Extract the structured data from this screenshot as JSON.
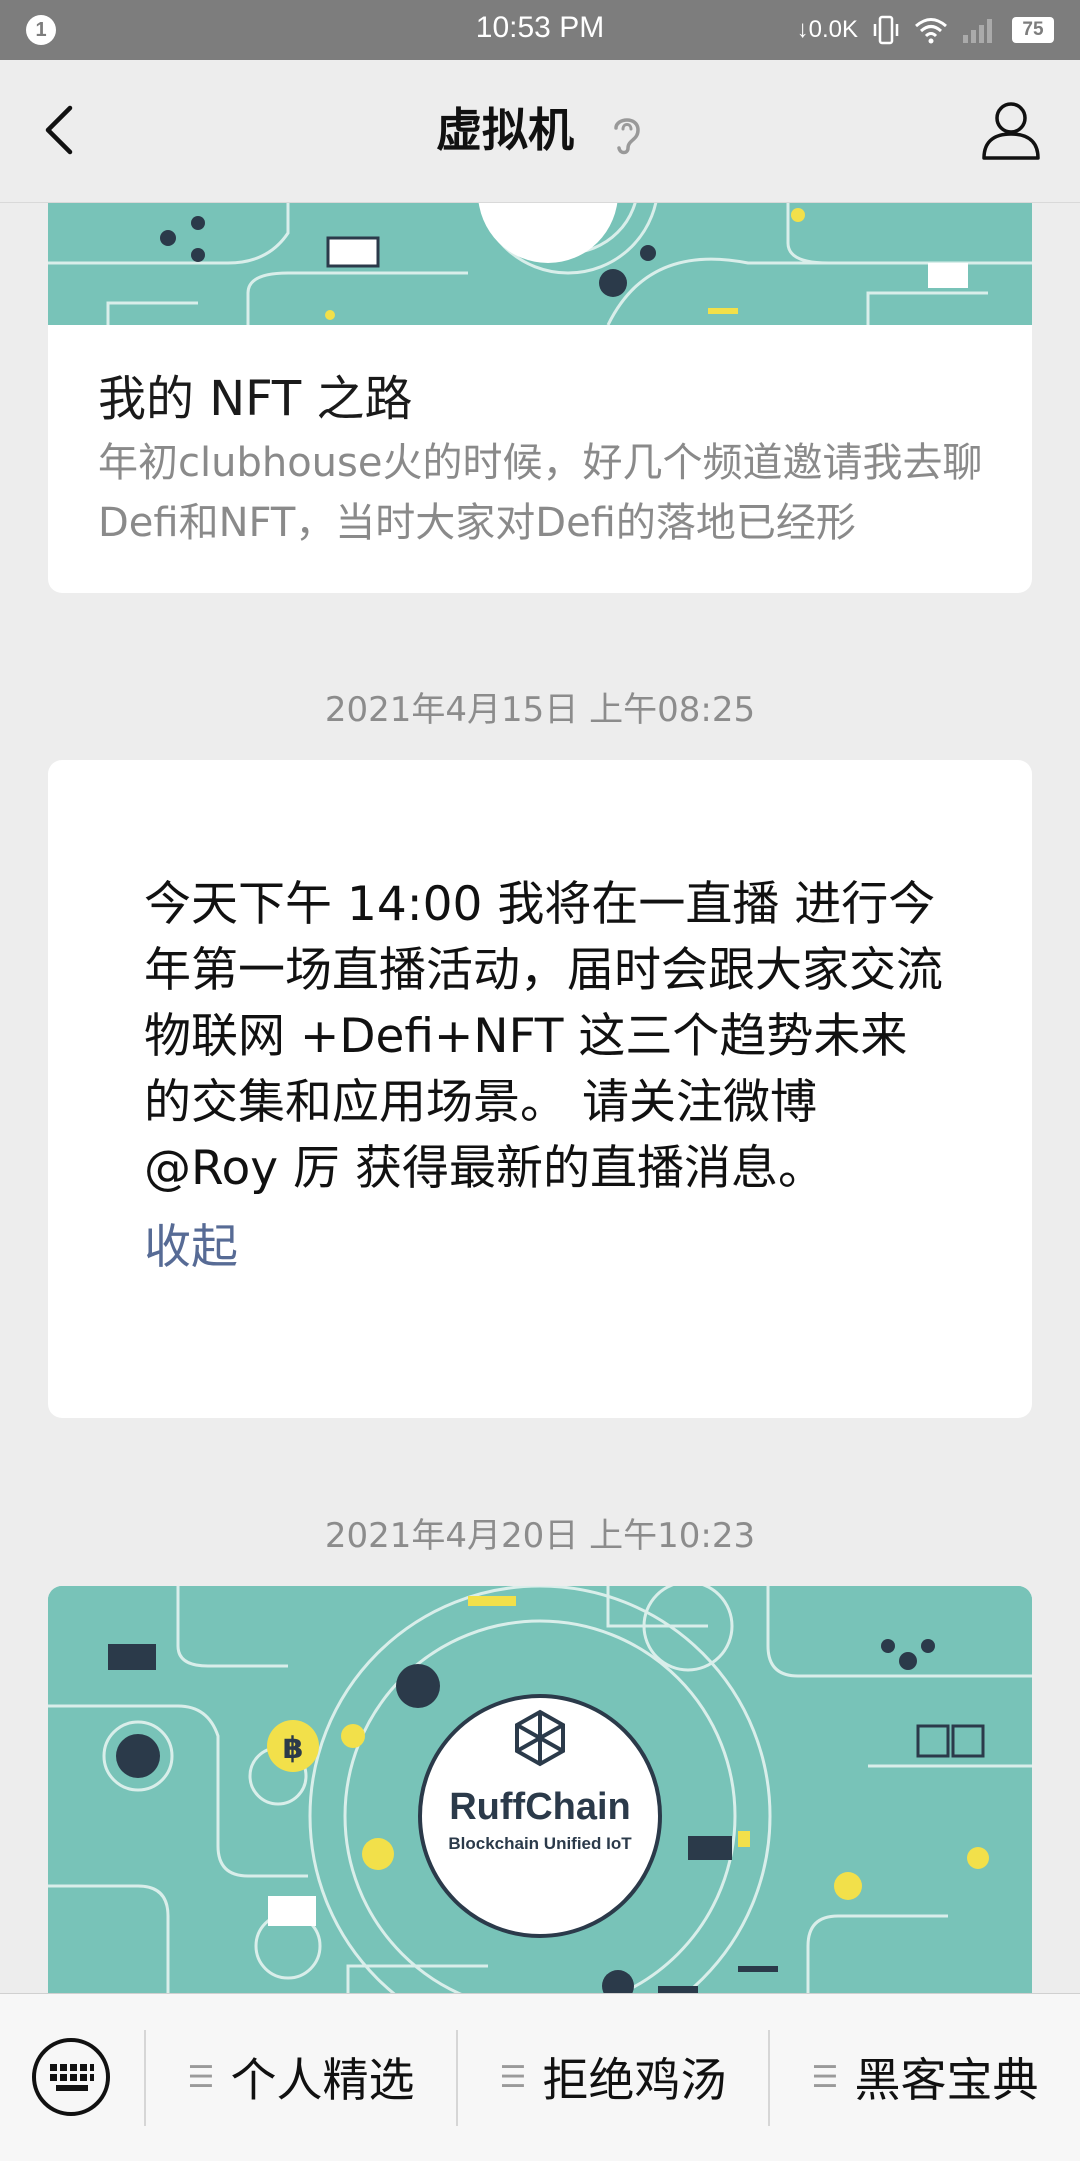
{
  "status_bar": {
    "notification_count": "1",
    "time": "10:53 PM",
    "net_speed": "↓0.0K",
    "battery": "75"
  },
  "header": {
    "title": "虚拟机"
  },
  "article": {
    "title": "我的 NFT 之路",
    "summary": "年初clubhouse火的时候，好几个频道邀请我去聊Defi和NFT，当时大家对Defi的落地已经形"
  },
  "messages": [
    {
      "timestamp": "2021年4月15日 上午08:25",
      "text": "今天下午 14:00 我将在一直播 进行今年第一场直播活动，届时会跟大家交流物联网 +Defi+NFT 这三个趋势未来的交集和应用场景。 请关注微博 @Roy 厉 获得最新的直播消息。",
      "collapse_label": "收起"
    },
    {
      "timestamp": "2021年4月20日 上午10:23",
      "brand": "RuffChain",
      "brand_tagline": "Blockchain Unified IoT"
    }
  ],
  "bottom_menu": [
    {
      "label": "个人精选"
    },
    {
      "label": "拒绝鸡汤"
    },
    {
      "label": "黑客宝典"
    }
  ],
  "colors": {
    "banner": "#78c3b8",
    "link": "#576b95",
    "accent_yellow": "#f2e04a"
  }
}
